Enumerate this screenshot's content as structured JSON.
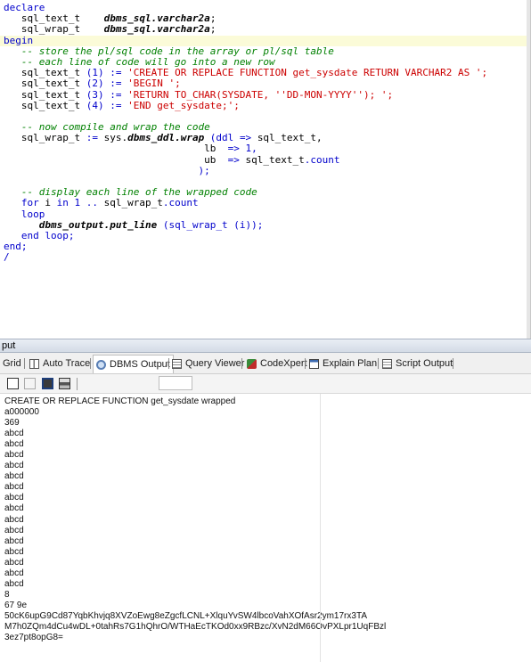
{
  "editor": {
    "lines": [
      [
        {
          "t": "declare",
          "c": "kw"
        }
      ],
      [
        {
          "t": "   sql_text_t    ",
          "c": "id"
        },
        {
          "t": "dbms_sql.varchar2a",
          "c": "bi"
        },
        {
          "t": ";",
          "c": "id"
        }
      ],
      [
        {
          "t": "   sql_wrap_t    ",
          "c": "id"
        },
        {
          "t": "dbms_sql.varchar2a",
          "c": "bi"
        },
        {
          "t": ";",
          "c": "id"
        }
      ],
      [
        {
          "t": "begin",
          "c": "kw",
          "hl": true
        }
      ],
      [
        {
          "t": "   -- store the pl/sql code in the array or pl/sql table",
          "c": "cm"
        }
      ],
      [
        {
          "t": "   -- each line of code will go into a new row",
          "c": "cm"
        }
      ],
      [
        {
          "t": "   sql_text_t ",
          "c": "id"
        },
        {
          "t": "(1)",
          "c": "kw"
        },
        {
          "t": " := ",
          "c": "kw"
        },
        {
          "t": "'CREATE OR REPLACE FUNCTION get_sysdate RETURN VARCHAR2 AS ';",
          "c": "str"
        }
      ],
      [
        {
          "t": "   sql_text_t ",
          "c": "id"
        },
        {
          "t": "(2)",
          "c": "kw"
        },
        {
          "t": " := ",
          "c": "kw"
        },
        {
          "t": "'BEGIN ';",
          "c": "str"
        }
      ],
      [
        {
          "t": "   sql_text_t ",
          "c": "id"
        },
        {
          "t": "(3)",
          "c": "kw"
        },
        {
          "t": " := ",
          "c": "kw"
        },
        {
          "t": "'RETURN TO_CHAR(SYSDATE, ''DD-MON-YYYY''); ';",
          "c": "str"
        }
      ],
      [
        {
          "t": "   sql_text_t ",
          "c": "id"
        },
        {
          "t": "(4)",
          "c": "kw"
        },
        {
          "t": " := ",
          "c": "kw"
        },
        {
          "t": "'END get_sysdate;';",
          "c": "str"
        }
      ],
      [
        {
          "t": "",
          "c": "id"
        }
      ],
      [
        {
          "t": "   -- now compile and wrap the code",
          "c": "cm"
        }
      ],
      [
        {
          "t": "   sql_wrap_t ",
          "c": "id"
        },
        {
          "t": ":= ",
          "c": "kw"
        },
        {
          "t": "sys.",
          "c": "id"
        },
        {
          "t": "dbms_ddl.wrap",
          "c": "bi"
        },
        {
          "t": " (ddl ",
          "c": "kw"
        },
        {
          "t": "=> ",
          "c": "kw"
        },
        {
          "t": "sql_text_t,",
          "c": "id"
        }
      ],
      [
        {
          "t": "                                  lb  ",
          "c": "id"
        },
        {
          "t": "=> 1,",
          "c": "kw"
        }
      ],
      [
        {
          "t": "                                  ub  ",
          "c": "id"
        },
        {
          "t": "=> ",
          "c": "kw"
        },
        {
          "t": "sql_text_t",
          "c": "id"
        },
        {
          "t": ".count",
          "c": "kw"
        }
      ],
      [
        {
          "t": "                                 );",
          "c": "kw"
        }
      ],
      [
        {
          "t": "",
          "c": "id"
        }
      ],
      [
        {
          "t": "   -- display each line of the wrapped code",
          "c": "cm"
        }
      ],
      [
        {
          "t": "   for ",
          "c": "kw"
        },
        {
          "t": "i ",
          "c": "id"
        },
        {
          "t": "in 1 .. ",
          "c": "kw"
        },
        {
          "t": "sql_wrap_t",
          "c": "id"
        },
        {
          "t": ".count",
          "c": "kw"
        }
      ],
      [
        {
          "t": "   loop",
          "c": "kw"
        }
      ],
      [
        {
          "t": "      ",
          "c": "id"
        },
        {
          "t": "dbms_output.put_line",
          "c": "bi"
        },
        {
          "t": " (sql_wrap_t (i));",
          "c": "kw"
        }
      ],
      [
        {
          "t": "   end loop;",
          "c": "kw"
        }
      ],
      [
        {
          "t": "end;",
          "c": "kw"
        }
      ],
      [
        {
          "t": "/",
          "c": "kw"
        }
      ]
    ]
  },
  "panel": {
    "title": "put"
  },
  "tabs": [
    {
      "label": "Grid",
      "icon": "grid-icon"
    },
    {
      "label": "Auto Trace",
      "icon": "auto-trace-icon"
    },
    {
      "label": "DBMS Output",
      "icon": "dbms-output-icon",
      "active": true
    },
    {
      "label": "Query Viewer",
      "icon": "query-viewer-icon"
    },
    {
      "label": "CodeXpert",
      "icon": "codexpert-icon"
    },
    {
      "label": "Explain Plan",
      "icon": "explain-plan-icon"
    },
    {
      "label": "Script Output",
      "icon": "script-output-icon"
    }
  ],
  "toolbar": {
    "icons": [
      "new-page-icon",
      "disabled-doc-icon",
      "save-icon",
      "print-icon"
    ]
  },
  "output": {
    "lines": [
      "CREATE OR REPLACE FUNCTION get_sysdate wrapped",
      "a000000",
      "369",
      "abcd",
      "abcd",
      "abcd",
      "abcd",
      "abcd",
      "abcd",
      "abcd",
      "abcd",
      "abcd",
      "abcd",
      "abcd",
      "abcd",
      "abcd",
      "abcd",
      "abcd",
      "8",
      "67 9e",
      "50cK6upG9Cd87YqbKhvjq8XVZoEwg8eZgcfLCNL+XlquYvSW4lbcoVahXOfAsr2ym17rx3TA",
      "M7h0ZQm4dCu4wDL+0tahRs7G1hQhrO/WTHaEcTKOd0xx9RBzc/XvN2dM66OvPXLpr1UqFBzl",
      "3ez7pt8opG8="
    ]
  }
}
